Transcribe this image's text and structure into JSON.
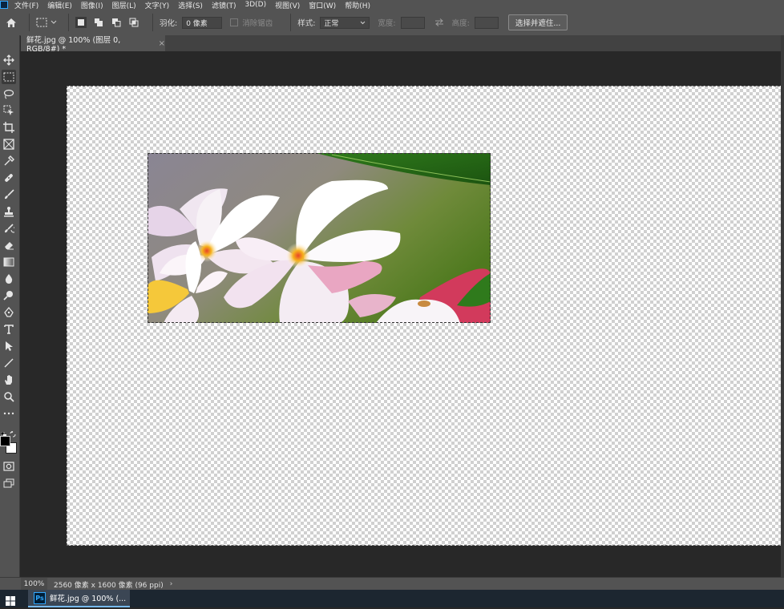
{
  "menu": [
    "文件(F)",
    "编辑(E)",
    "图像(I)",
    "图层(L)",
    "文字(Y)",
    "选择(S)",
    "滤镜(T)",
    "3D(D)",
    "视图(V)",
    "窗口(W)",
    "帮助(H)"
  ],
  "options": {
    "feather_label": "羽化:",
    "feather_value": "0 像素",
    "antialias_label": "消除锯齿",
    "style_label": "样式:",
    "style_value": "正常",
    "width_label": "宽度:",
    "height_label": "高度:",
    "select_mask_button": "选择并遮住..."
  },
  "document": {
    "tab_title": "鲜花.jpg @ 100% (图层 0, RGB/8#) *",
    "tab_close": "×"
  },
  "status": {
    "zoom": "100%",
    "doc_info": "2560 像素 x 1600 像素 (96 ppi)",
    "arrow": "›"
  },
  "taskbar": {
    "app_badge": "Ps",
    "item_label": "鲜花.jpg @ 100% (..."
  },
  "colors": {
    "panel": "#535353",
    "workspace": "#282828",
    "accent": "#31a8ff"
  },
  "tools": [
    "move-tool-icon",
    "marquee-tool-icon",
    "lasso-tool-icon",
    "object-select-icon",
    "crop-tool-icon",
    "frame-tool-icon",
    "eyedropper-icon",
    "healing-brush-icon",
    "brush-tool-icon",
    "stamp-tool-icon",
    "history-brush-icon",
    "eraser-icon",
    "gradient-icon",
    "blur-drop-icon",
    "dodge-icon",
    "pen-tool-icon",
    "type-tool-icon",
    "path-select-icon",
    "line-tool-icon",
    "hand-tool-icon",
    "zoom-tool-icon",
    "more-tools-icon"
  ]
}
